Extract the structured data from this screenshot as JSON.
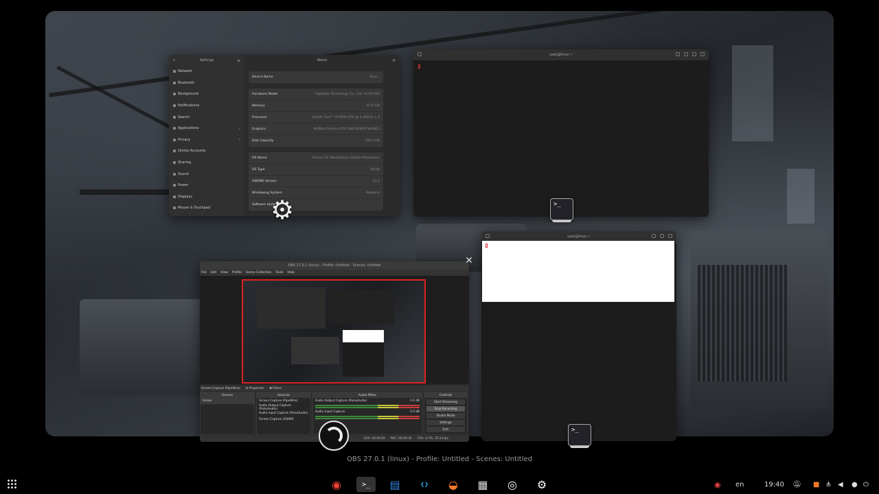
{
  "settings": {
    "sidebar_title": "Settings",
    "main_title": "About",
    "sidebar_items": [
      {
        "label": "Network",
        "chevron": ""
      },
      {
        "label": "Bluetooth",
        "chevron": ""
      },
      {
        "label": "Background",
        "chevron": ""
      },
      {
        "label": "Notifications",
        "chevron": ""
      },
      {
        "label": "Search",
        "chevron": ""
      },
      {
        "label": "Applications",
        "chevron": "›"
      },
      {
        "label": "Privacy",
        "chevron": "›"
      },
      {
        "label": "Online Accounts",
        "chevron": ""
      },
      {
        "label": "Sharing",
        "chevron": ""
      },
      {
        "label": "Sound",
        "chevron": ""
      },
      {
        "label": "Power",
        "chevron": ""
      },
      {
        "label": "Displays",
        "chevron": ""
      },
      {
        "label": "Mouse & Touchpad",
        "chevron": ""
      }
    ],
    "device_name": {
      "label": "Device Name",
      "value": "linux ›"
    },
    "hardware": [
      {
        "label": "Hardware Model",
        "value": "Gigabyte Technology Co., Ltd. H170-HD3"
      },
      {
        "label": "Memory",
        "value": "15.6 GiB"
      },
      {
        "label": "Processor",
        "value": "Intel® Core™ i5-6500 CPU @ 3.20GHz × 4"
      },
      {
        "label": "Graphics",
        "value": "NVIDIA GeForce GTX 1060 6GB/PCIe/SSE2"
      },
      {
        "label": "Disk Capacity",
        "value": "256.1 GB"
      }
    ],
    "os": [
      {
        "label": "OS Name",
        "value": "Fedora 35 (Workstation Edition Prerelease)"
      },
      {
        "label": "OS Type",
        "value": "64-bit"
      },
      {
        "label": "GNOME Version",
        "value": "41.2"
      },
      {
        "label": "Windowing System",
        "value": "Wayland"
      },
      {
        "label": "Software Updates",
        "value": "›"
      }
    ]
  },
  "terminal1": {
    "title": "user@linux:~"
  },
  "terminal2": {
    "title": "user@linux:~"
  },
  "terminal_icon_glyph": ">_",
  "obs": {
    "title": "OBS 27.0.1 (linux) - Profile: Untitled - Scenes: Untitled",
    "menu": [
      "File",
      "Edit",
      "View",
      "Profile",
      "Scene Collection",
      "Tools",
      "Help"
    ],
    "source_bar": {
      "name": "Screen Capture (PipeWire)",
      "properties": "⚙ Properties",
      "filters": "⧉ Filters"
    },
    "scenes": {
      "title": "Scenes",
      "items": [
        "Scene"
      ]
    },
    "sources": {
      "title": "Sources",
      "items": [
        "Screen Capture (PipeWire)",
        "Audio Output Capture (PulseAudio)",
        "Audio Input Capture (PulseAudio)",
        "Screen Capture (XSHM)"
      ]
    },
    "mixer": {
      "title": "Audio Mixer",
      "channels": [
        {
          "name": "Audio Output Capture (PulseAudio)",
          "db": "0.0 dB"
        },
        {
          "name": "Audio Input Capture",
          "db": "0.0 dB"
        }
      ]
    },
    "controls": {
      "title": "Controls",
      "buttons": [
        "Start Streaming",
        "Stop Recording",
        "Studio Mode",
        "Settings",
        "Exit"
      ]
    },
    "status": {
      "live": "LIVE: 00:00:00",
      "rec": "REC: 00:00:36",
      "cpu": "CPU: 4.7%, 30.14 fps"
    }
  },
  "window_caption": "OBS 27.0.1 (linux) - Profile: Untitled - Scenes: Untitled",
  "taskbar": {
    "apps": [
      {
        "name": "chrome",
        "glyph": "◉",
        "color": "#ea4335"
      },
      {
        "name": "terminal",
        "glyph": ">_",
        "color": "#ffffff"
      },
      {
        "name": "text-editor",
        "glyph": "▤",
        "color": "#3584e4"
      },
      {
        "name": "vscode",
        "glyph": "❮❯",
        "color": "#23a9f2"
      },
      {
        "name": "blender",
        "glyph": "◒",
        "color": "#f5792a"
      },
      {
        "name": "calculator",
        "glyph": "▦",
        "color": "#dddddd"
      },
      {
        "name": "obs",
        "glyph": "◎",
        "color": "#ffffff"
      },
      {
        "name": "settings",
        "glyph": "⚙",
        "color": "#ffffff"
      }
    ],
    "language": "en",
    "clock": "19:40"
  }
}
